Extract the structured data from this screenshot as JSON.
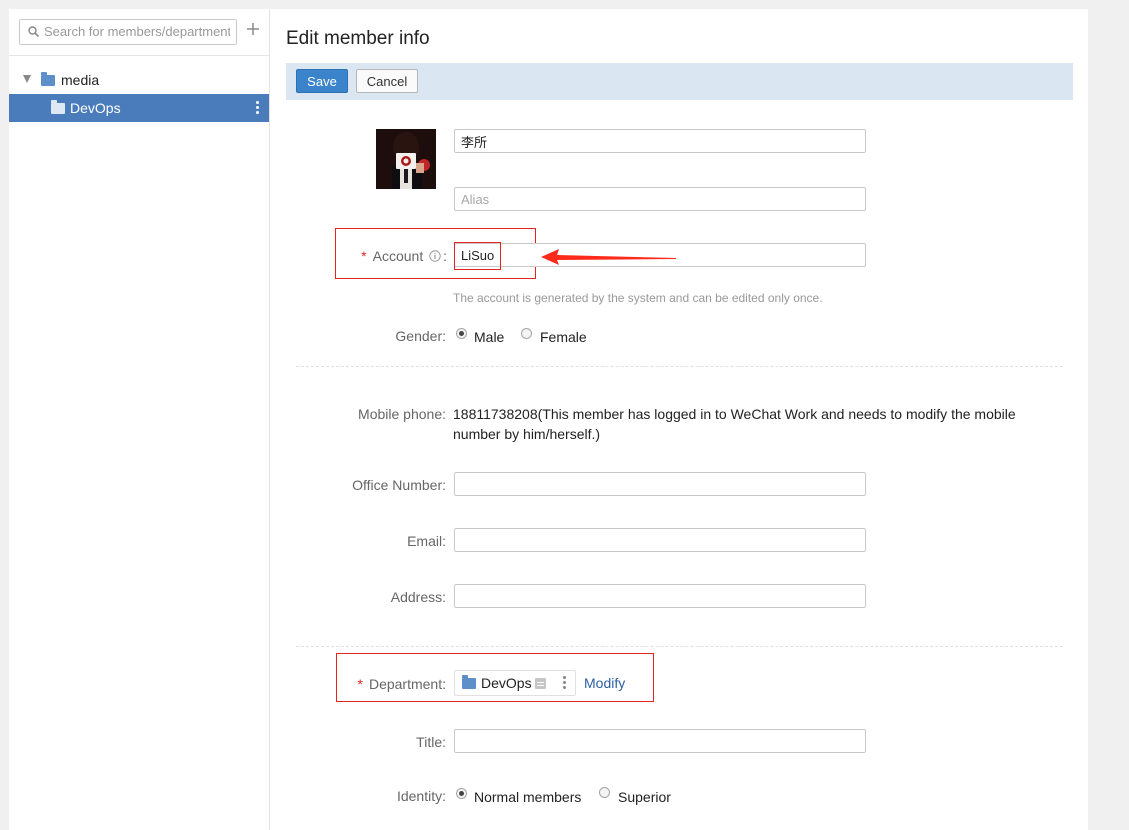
{
  "sidebar": {
    "search_placeholder": "Search for members/departments",
    "tree": {
      "root_label": "media",
      "child_label": "DevOps"
    }
  },
  "main": {
    "title": "Edit member info",
    "toolbar": {
      "save_label": "Save",
      "cancel_label": "Cancel"
    },
    "name_value": "李所",
    "alias_placeholder": "Alias",
    "account": {
      "label": "Account",
      "required_mark": "*",
      "value": "LiSuo",
      "hint": "The account is generated by the system and can be edited only once."
    },
    "gender": {
      "label": "Gender:",
      "options": [
        "Male",
        "Female"
      ],
      "selected": "Male"
    },
    "mobile": {
      "label": "Mobile phone:",
      "text": "18811738208(This member has logged in to WeChat Work and needs to modify the mobile number by him/herself.)"
    },
    "office_number": {
      "label": "Office Number:",
      "value": ""
    },
    "email": {
      "label": "Email:",
      "value": ""
    },
    "address": {
      "label": "Address:",
      "value": ""
    },
    "department": {
      "label": "Department:",
      "required_mark": "*",
      "chip_label": "DevOps",
      "modify_label": "Modify"
    },
    "title_field": {
      "label": "Title:",
      "value": ""
    },
    "identity": {
      "label": "Identity:",
      "options": [
        "Normal members",
        "Superior"
      ],
      "selected": "Normal members"
    }
  },
  "colors": {
    "accent": "#3b84cb",
    "selected_tree_bg": "#4a7bbb",
    "required": "#e2261c",
    "link": "#2c5fa5",
    "toolbar_bg": "#dbe6f3"
  }
}
